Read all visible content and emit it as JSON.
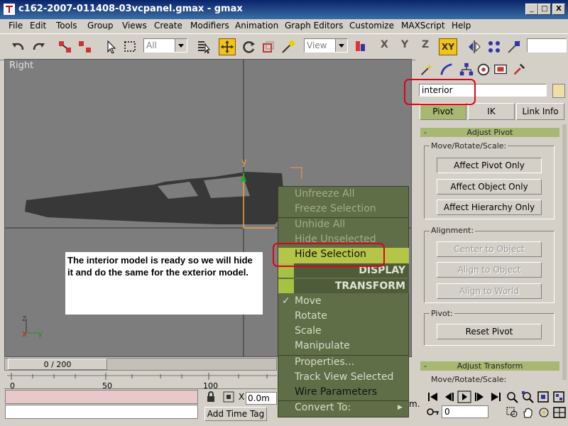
{
  "window": {
    "title": "c162-2007-011408-03vcpanel.gmax - gmax",
    "minimize_glyph": "_",
    "maximize_glyph": "□",
    "close_glyph": "X"
  },
  "menu": {
    "items": [
      "File",
      "Edit",
      "Tools",
      "Group",
      "Views",
      "Create",
      "Modifiers",
      "Animation",
      "Graph Editors",
      "Customize",
      "MAXScript",
      "Help"
    ]
  },
  "toolbar": {
    "selection_filter": "All",
    "reference_coord": "View",
    "axis_x": "X",
    "axis_y": "Y",
    "axis_z": "Z",
    "axis_xy": "XY"
  },
  "viewport": {
    "label": "Right",
    "axis_y_label": "y",
    "tripod_z": "z",
    "tripod_x": "x",
    "tripod_y": "y"
  },
  "quad_menu": {
    "unfreeze_all": "Unfreeze All",
    "freeze_selection": "Freeze Selection",
    "unhide_all": "Unhide All",
    "hide_unselected": "Hide Unselected",
    "hide_selection": "Hide Selection",
    "display_header": "DISPLAY",
    "transform_header": "TRANSFORM",
    "move_check": "✓",
    "move": "Move",
    "rotate": "Rotate",
    "scale": "Scale",
    "manipulate": "Manipulate",
    "properties": "Properties...",
    "track_view_selected": "Track View Selected",
    "wire_parameters": "Wire Parameters",
    "convert_to": "Convert To:",
    "submenu_arrow": "▶"
  },
  "annotation": {
    "text": "The interior model is ready so we will hide it and do the same for the exterior model."
  },
  "command_panel": {
    "object_name": "interior",
    "color_swatch": "#f0dfa5",
    "tabs": {
      "pivot": "Pivot",
      "ik": "IK",
      "link_info": "Link Info"
    },
    "adjust_pivot": {
      "title": "Adjust Pivot",
      "collapse_glyph": "-",
      "move_rotate_scale_label": "Move/Rotate/Scale:",
      "affect_pivot_only": "Affect Pivot Only",
      "affect_object_only": "Affect Object Only",
      "affect_hierarchy_only": "Affect Hierarchy Only",
      "alignment_label": "Alignment:",
      "center_to_object": "Center to Object",
      "align_to_object": "Align to Object",
      "align_to_world": "Align to World",
      "pivot_label": "Pivot:",
      "reset_pivot": "Reset Pivot"
    },
    "adjust_transform": {
      "title": "Adjust Transform",
      "collapse_glyph": "-",
      "move_rotate_scale_label": "Move/Rotate/Scale:"
    }
  },
  "timeline": {
    "frame_range": "0 / 200",
    "tick_0": "0",
    "tick_50": "50",
    "tick_100": "100",
    "x_label": "X",
    "x_value": "0.0m",
    "add_time_tag": "Add Time Tag",
    "current_frame": "0",
    "partial_label": "m."
  },
  "colors": {
    "quad_bg": "#5f6e46",
    "quad_highlight": "#b5c548",
    "active_tool": "#f3c31a",
    "highlight_ring": "#e3001b"
  }
}
